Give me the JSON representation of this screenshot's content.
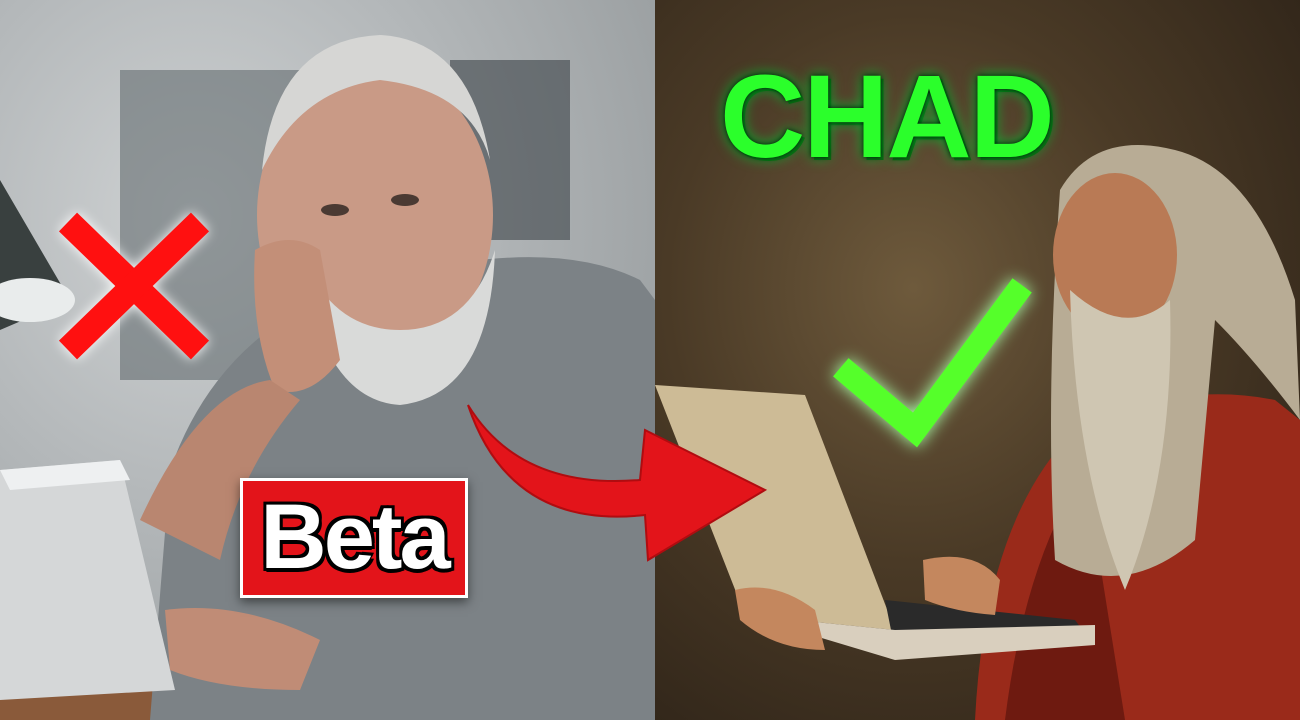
{
  "left": {
    "label": "Beta",
    "mark": "cross-icon",
    "mark_color": "#ff1010",
    "badge_color": "#e3141a"
  },
  "right": {
    "label": "CHAD",
    "label_color": "#2bff2b",
    "mark": "check-icon",
    "mark_color": "#55ff2a"
  },
  "arrow": {
    "icon": "curved-arrow-icon",
    "color": "#e3141a"
  }
}
